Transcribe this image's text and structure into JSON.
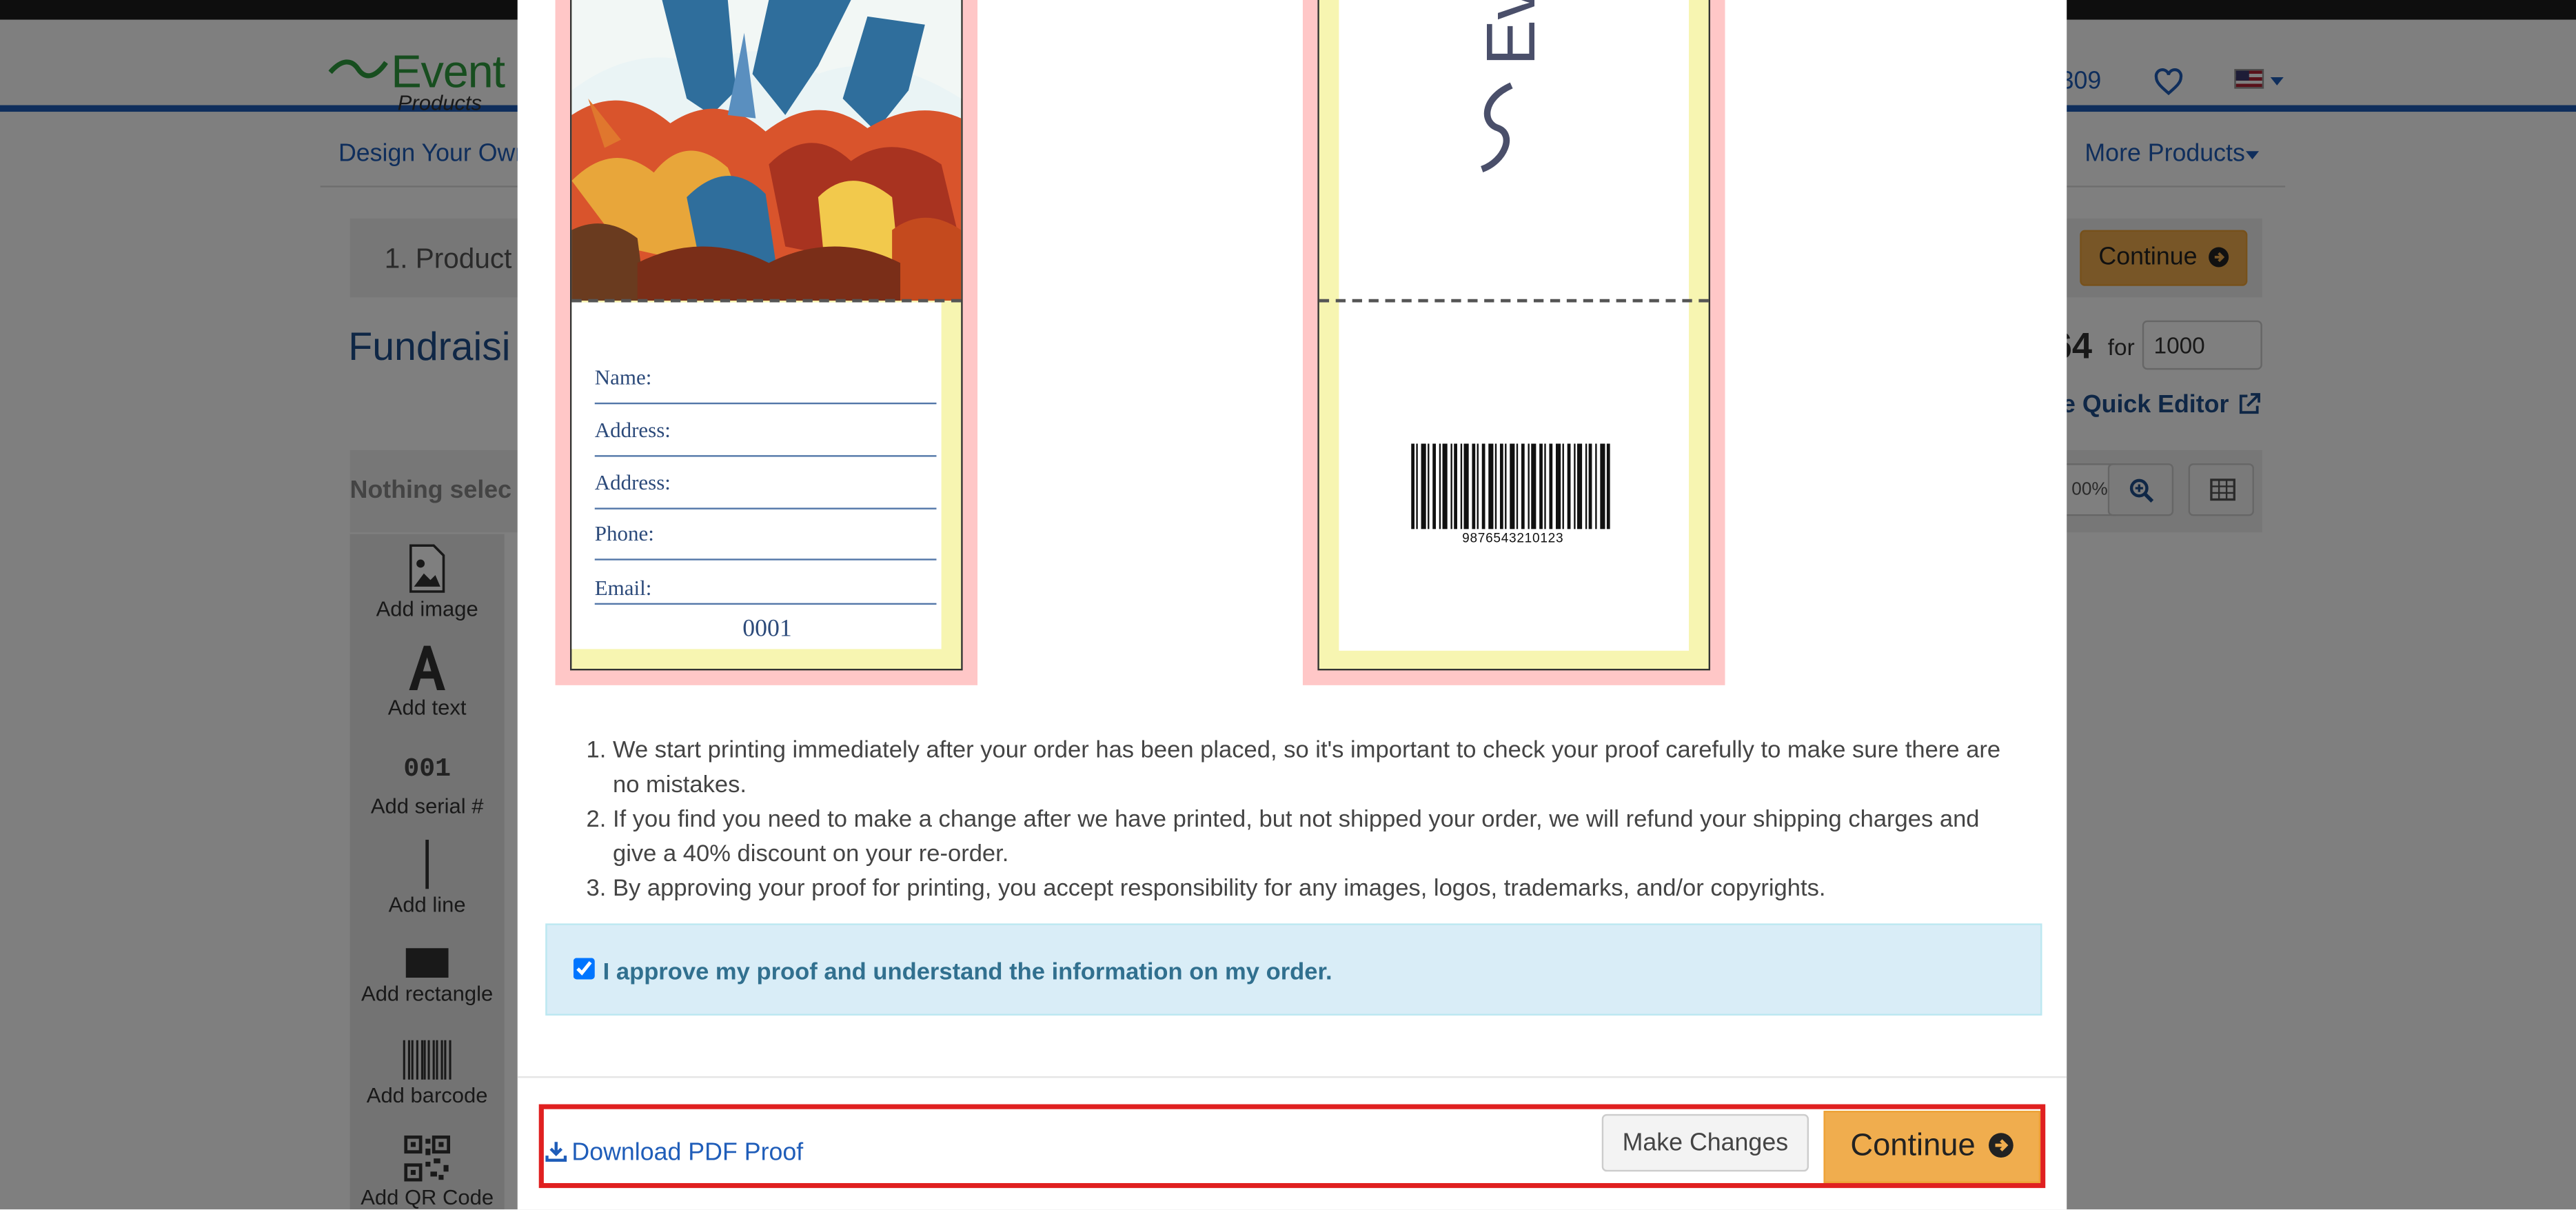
{
  "header": {
    "logo_word": "Event",
    "logo_sub": "Products",
    "phone_fragment": "309",
    "icons": [
      "heart-icon",
      "us-flag-icon",
      "caret-down-icon"
    ]
  },
  "nav": {
    "design_your_own": "Design Your Own",
    "more_products": "More Products"
  },
  "steps": {
    "current": "1. Product",
    "continue_label": "Continue"
  },
  "product": {
    "title": "Fundraisi",
    "price_fragment": "64",
    "for_label": "for",
    "quantity": "1000",
    "quick_editor_label": "e Quick Editor"
  },
  "toolbar": {
    "nothing_selected": "Nothing selec",
    "zoom_fragment": "00%"
  },
  "tools": [
    {
      "label": "Add image",
      "icon": "image-icon"
    },
    {
      "label": "Add text",
      "icon": "text-icon"
    },
    {
      "label": "Add serial #",
      "icon": "serial-icon"
    },
    {
      "label": "Add line",
      "icon": "line-icon"
    },
    {
      "label": "Add rectangle",
      "icon": "rectangle-icon"
    },
    {
      "label": "Add barcode",
      "icon": "barcode-icon"
    },
    {
      "label": "Add QR Code",
      "icon": "qr-code-icon"
    }
  ],
  "proof": {
    "front": {
      "top_serial": "0001",
      "fields": [
        "Name:",
        "Address:",
        "Address:",
        "Phone:",
        "Email:"
      ],
      "serial": "0001"
    },
    "back": {
      "logo_text": "Ev",
      "barcode_number": "9876543210123"
    }
  },
  "modal": {
    "terms": [
      "We start printing immediately after your order has been placed, so it's important to check your proof carefully to make sure there are no mistakes.",
      "If you find you need to make a change after we have printed, but not shipped your order, we will refund your shipping charges and give a 40% discount on your re-order.",
      "By approving your proof for printing, you accept responsibility for any images, logos, trademarks, and/or copyrights."
    ],
    "approve_text": "I approve my proof and understand the information on my order.",
    "approve_checked": true,
    "download_label": "Download PDF Proof",
    "make_changes_label": "Make Changes",
    "continue_label": "Continue"
  },
  "colors": {
    "brand_blue": "#1f5db9",
    "accent_orange": "#f0ad4e",
    "highlight_red": "#e02020",
    "info_bg": "#d9edf7"
  }
}
